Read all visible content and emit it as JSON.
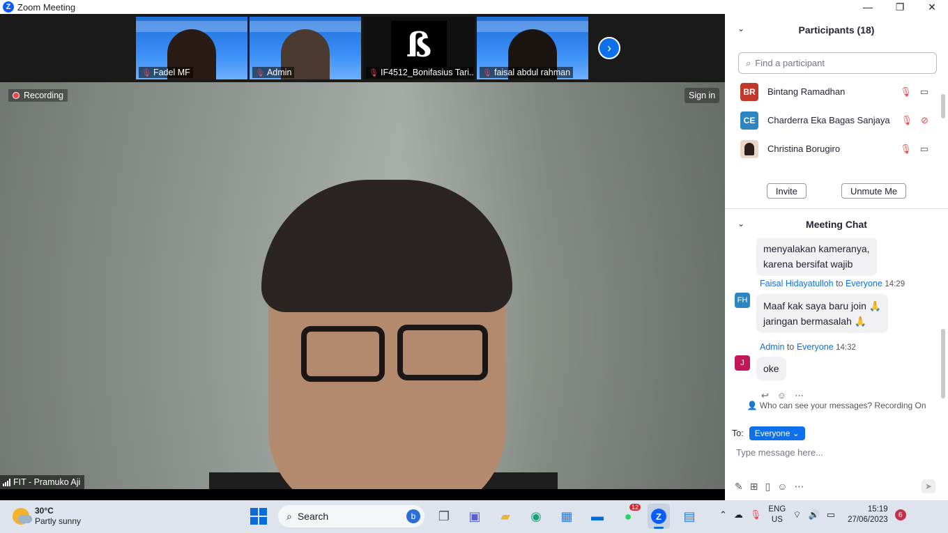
{
  "window": {
    "title": "Zoom Meeting",
    "app_logo": "Z",
    "minimize_glyph": "—",
    "maximize_glyph": "❐",
    "close_glyph": "✕"
  },
  "thumbnails": [
    {
      "name": "Fadel MF",
      "mic": "muted"
    },
    {
      "name": "Admin",
      "mic": "muted"
    },
    {
      "name": "IF4512_Bonifasius Tari...",
      "mic": "muted",
      "logo": "ß"
    },
    {
      "name": "faisal abdul rahman",
      "mic": "muted"
    }
  ],
  "main_video": {
    "recording_label": "Recording",
    "sign_in_label": "Sign in",
    "speaker_name": "FIT - Pramuko Aji"
  },
  "participants_panel": {
    "title": "Participants (18)",
    "search_placeholder": "Find a participant",
    "participants": [
      {
        "initials": "BR",
        "name": "Bintang Ramadhan",
        "avatar_color": "#c0392b",
        "mic": "muted",
        "video": "on"
      },
      {
        "initials": "CE",
        "name": "Charderra Eka Bagas Sanjaya",
        "avatar_color": "#2e86c1",
        "mic": "muted",
        "video": "off"
      },
      {
        "initials": "",
        "name": "Christina Borugiro",
        "avatar_color": "#e8d6c8",
        "mic": "muted",
        "video": "on"
      }
    ],
    "invite_label": "Invite",
    "unmute_label": "Unmute Me"
  },
  "chat_panel": {
    "title": "Meeting Chat",
    "partial_message": [
      "menyalakan kameranya,",
      "karena bersifat wajib"
    ],
    "messages": [
      {
        "initials": "FH",
        "avatar_color": "#2e86c1",
        "sender": "Faisal Hidayatulloh",
        "to_word": "to",
        "recipient": "Everyone",
        "time": "14:29",
        "lines": [
          "Maaf kak saya baru join 🙏",
          "jaringan bermasalah 🙏"
        ]
      },
      {
        "initials": "J",
        "avatar_color": "#c2185b",
        "sender": "Admin",
        "to_word": "to",
        "recipient": "Everyone",
        "time": "14:32",
        "lines": [
          "oke"
        ]
      }
    ],
    "visibility_note": "Who can see your messages? Recording On",
    "to_label": "To:",
    "to_value": "Everyone",
    "input_placeholder": "Type message here..."
  },
  "taskbar": {
    "weather_temp": "30°C",
    "weather_desc": "Partly sunny",
    "search_label": "Search",
    "whatsapp_badge": "12",
    "lang_line1": "ENG",
    "lang_line2": "US",
    "time": "15:19",
    "date": "27/06/2023",
    "notification_count": "6"
  }
}
